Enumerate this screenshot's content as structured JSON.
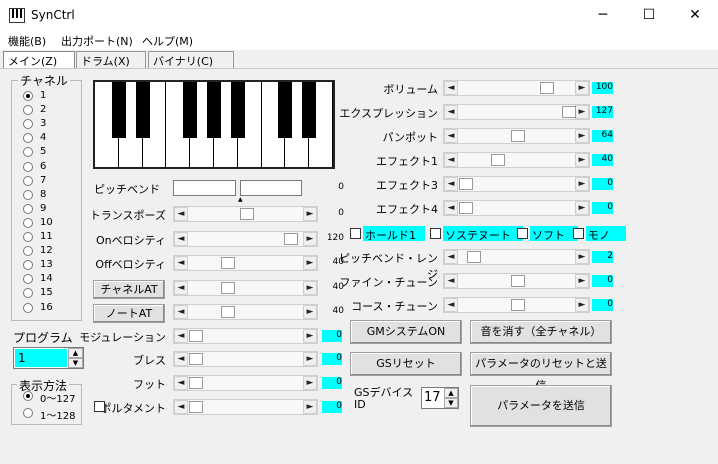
{
  "window": {
    "title": "SynCtrl",
    "minimize": "─",
    "maximize": "☐",
    "close": "✕"
  },
  "menu": [
    "機能(B)",
    "出力ポート(N)",
    "ヘルプ(M)"
  ],
  "tabs": [
    "メイン(Z)",
    "ドラム(X)",
    "バイナリ(C)"
  ],
  "channel": {
    "label": "チャネル",
    "options": [
      "1",
      "2",
      "3",
      "4",
      "5",
      "6",
      "7",
      "8",
      "9",
      "10",
      "11",
      "12",
      "13",
      "14",
      "15",
      "16"
    ],
    "selected": "1"
  },
  "program": {
    "label": "プログラム",
    "value": "1"
  },
  "display": {
    "label": "表示方法",
    "options": [
      "0〜127",
      "1〜128"
    ],
    "selected": "0〜127"
  },
  "left_controls": {
    "pitchbend": {
      "label": "ピッチベンド",
      "value": "0"
    },
    "transpose": {
      "label": "トランスポーズ",
      "value": "0"
    },
    "on_velocity": {
      "label": "Onベロシティ",
      "value": "120"
    },
    "off_velocity": {
      "label": "Offベロシティ",
      "value": "40"
    },
    "channel_at": {
      "label": "チャネルAT",
      "value": "40"
    },
    "note_at": {
      "label": "ノートAT",
      "value": "40"
    },
    "modulation": {
      "label": "モジュレーション",
      "value": "0"
    },
    "breath": {
      "label": "ブレス",
      "value": "0"
    },
    "foot": {
      "label": "フット",
      "value": "0"
    },
    "portamento": {
      "label": "ポルタメント",
      "value": "0"
    }
  },
  "right_controls": {
    "volume": {
      "label": "ボリューム",
      "value": "100"
    },
    "expression": {
      "label": "エクスプレッション",
      "value": "127"
    },
    "panpot": {
      "label": "パンポット",
      "value": "64"
    },
    "effect1": {
      "label": "エフェクト1",
      "value": "40"
    },
    "effect3": {
      "label": "エフェクト3",
      "value": "0"
    },
    "effect4": {
      "label": "エフェクト4",
      "value": "0"
    },
    "pb_range": {
      "label": "ピッチベンド・レンジ",
      "value": "2"
    },
    "fine_tune": {
      "label": "ファイン・チューン",
      "value": "0"
    },
    "coarse_tune": {
      "label": "コース・チューン",
      "value": "0"
    }
  },
  "checkboxes": [
    "ホールド1",
    "ソステヌート",
    "ソフト",
    "モノ"
  ],
  "buttons": {
    "gm_on": "GMシステムON",
    "mute_all": "音を消す（全チャネル）",
    "gs_reset": "GSリセット",
    "reset_send": "パラメータのリセットと送信",
    "send": "パラメータを送信"
  },
  "gs_device": {
    "label": "GSデバイスID",
    "value": "17"
  }
}
